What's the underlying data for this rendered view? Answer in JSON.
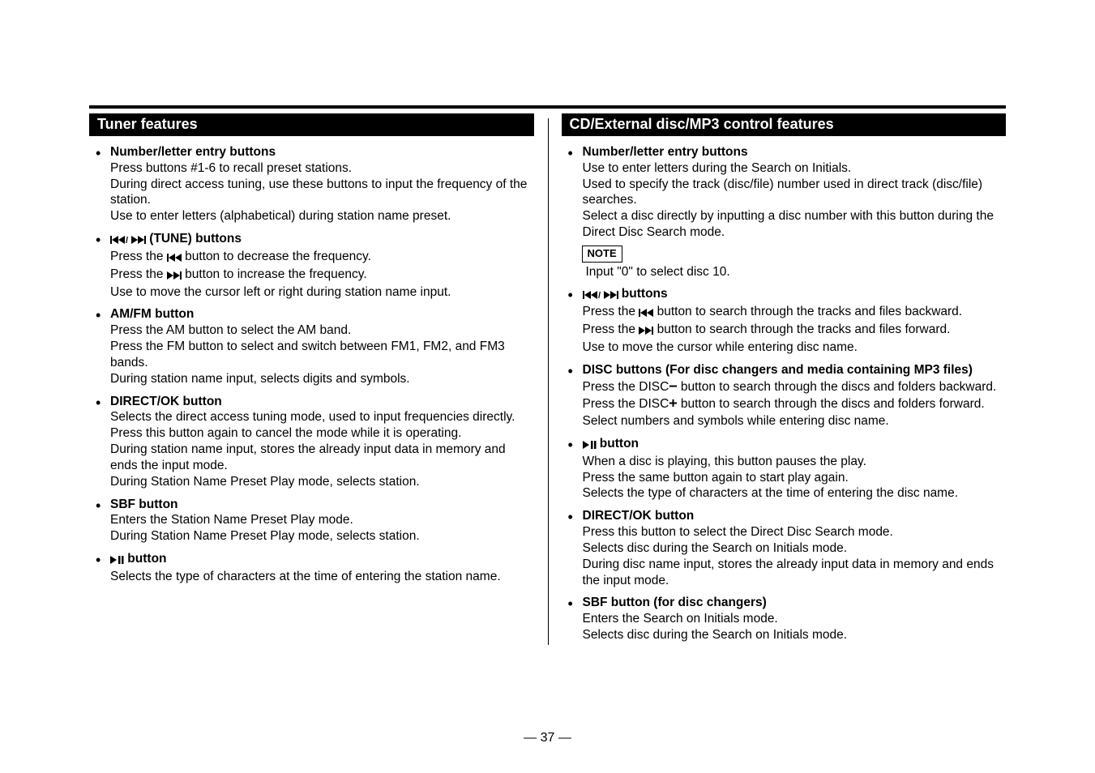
{
  "page_number": "— 37 —",
  "left": {
    "header": "Tuner features",
    "items": [
      {
        "title": "Number/letter entry buttons",
        "body": "Press buttons #1-6 to recall preset stations.\nDuring direct access tuning, use these buttons to input the frequency of the station.\nUse to enter letters (alphabetical) during station name preset."
      },
      {
        "title_pre": "",
        "title_icon": "prev-next",
        "title_post": " (TUNE) buttons",
        "body_parts": [
          {
            "t": "Press the ",
            "icon": "prev",
            "after": " button to decrease the frequency."
          },
          {
            "t": "Press the ",
            "icon": "next",
            "after": " button to increase the frequency."
          },
          {
            "t": "Use to move the cursor left or right during station name input."
          }
        ]
      },
      {
        "title": "AM/FM button",
        "body": "Press the AM button to select the AM band.\nPress the FM button to select and switch between FM1, FM2, and FM3 bands.\nDuring station name input, selects digits and symbols."
      },
      {
        "title": "DIRECT/OK button",
        "body": "Selects the direct access tuning mode, used to input frequencies directly. Press this button again to cancel the mode while it is operating.\nDuring station name input, stores the already input data in memory and ends the input mode.\nDuring Station Name Preset Play mode, selects station."
      },
      {
        "title": "SBF button",
        "body": "Enters the Station Name Preset Play mode.\nDuring Station Name Preset Play mode, selects station."
      },
      {
        "title_icon": "play-pause",
        "title_post": " button",
        "body": "Selects the type of characters at the time of entering the station name."
      }
    ]
  },
  "right": {
    "header": "CD/External disc/MP3 control features",
    "items": [
      {
        "title": "Number/letter entry buttons",
        "body": "Use to enter letters during the Search on Initials.\nUsed to specify the track (disc/file) number used in direct track (disc/file) searches.\nSelect a disc directly by inputting a disc number with this button during the Direct Disc Search mode.",
        "note_label": "NOTE",
        "note_text": "Input \"0\" to select disc 10."
      },
      {
        "title_icon": "prev-next",
        "title_post": " buttons",
        "body_parts": [
          {
            "t": "Press the ",
            "icon": "prev",
            "after": " button to search through the tracks and files backward."
          },
          {
            "t": "Press the ",
            "icon": "next",
            "after": " button to search through the tracks and files forward."
          },
          {
            "t": "Use to move the cursor while entering disc name."
          }
        ]
      },
      {
        "title": "DISC buttons (For disc changers and media containing MP3 files)",
        "body_parts": [
          {
            "t": "Press the DISC",
            "sym": "−",
            "after": " button to search through the discs and folders backward."
          },
          {
            "t": "Press the DISC",
            "sym": "+",
            "after": " button to search through the discs and folders forward."
          },
          {
            "t": "Select numbers and symbols while entering disc name."
          }
        ]
      },
      {
        "title_icon": "play-pause",
        "title_post": " button",
        "body": "When a disc is playing, this button pauses the play.\nPress the same button again to start play again.\nSelects the type of characters at the time of entering the disc name."
      },
      {
        "title": "DIRECT/OK button",
        "body": "Press this button to select the Direct Disc Search mode.\nSelects disc during the Search on Initials mode.\nDuring disc name input, stores the already input data in memory and ends the input mode."
      },
      {
        "title": "SBF button (for disc changers)",
        "body": "Enters the Search on Initials mode.\nSelects disc during the Search on Initials mode."
      }
    ]
  }
}
